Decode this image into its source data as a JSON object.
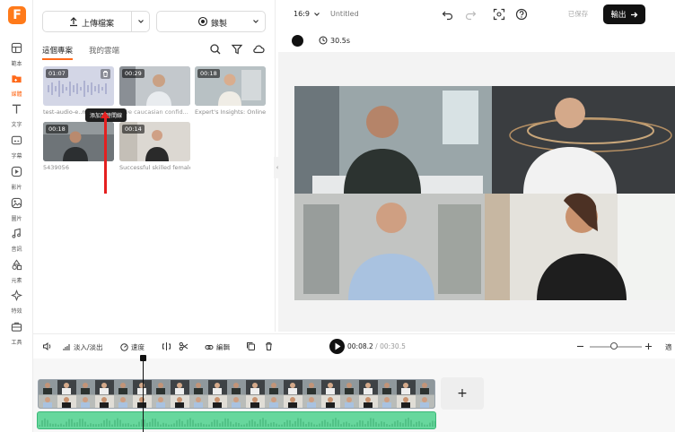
{
  "rail": {
    "items": [
      {
        "label": "範本",
        "icon": "layout-icon"
      },
      {
        "label": "媒體",
        "icon": "media-icon"
      },
      {
        "label": "文字",
        "icon": "text-icon"
      },
      {
        "label": "字幕",
        "icon": "subtitle-icon"
      },
      {
        "label": "影片",
        "icon": "video-icon"
      },
      {
        "label": "圖片",
        "icon": "image-icon"
      },
      {
        "label": "音訊",
        "icon": "music-icon"
      },
      {
        "label": "元素",
        "icon": "shapes-icon"
      },
      {
        "label": "特效",
        "icon": "effects-icon"
      },
      {
        "label": "工具",
        "icon": "toolbox-icon"
      }
    ]
  },
  "panel": {
    "upload_label": "上傳檔案",
    "record_label": "錄製",
    "tabs": [
      "這個專案",
      "我的雲端"
    ],
    "media": [
      {
        "duration": "01:07",
        "caption": "test-audio-e..mp..."
      },
      {
        "duration": "00:29",
        "caption": "...ve caucasian confid..."
      },
      {
        "duration": "00:18",
        "caption": "Expert's Insights: Online B..."
      },
      {
        "duration": "00:18",
        "caption": "5439056"
      },
      {
        "duration": "00:14",
        "caption": "Successful skilled female..."
      }
    ],
    "tooltip": "添加到時間線"
  },
  "header": {
    "aspect": "16:9",
    "title": "Untitled",
    "saved_label": "已保存",
    "export_label": "輸出"
  },
  "stage": {
    "duration": "30.5s",
    "bg_color": "#111111"
  },
  "timeline": {
    "tools": [
      "淡入/淡出",
      "速度",
      "編輯"
    ],
    "current_time": "00:08.2",
    "total_time": "/ 00:30.5",
    "add_label": "+",
    "edge_label": "適"
  }
}
